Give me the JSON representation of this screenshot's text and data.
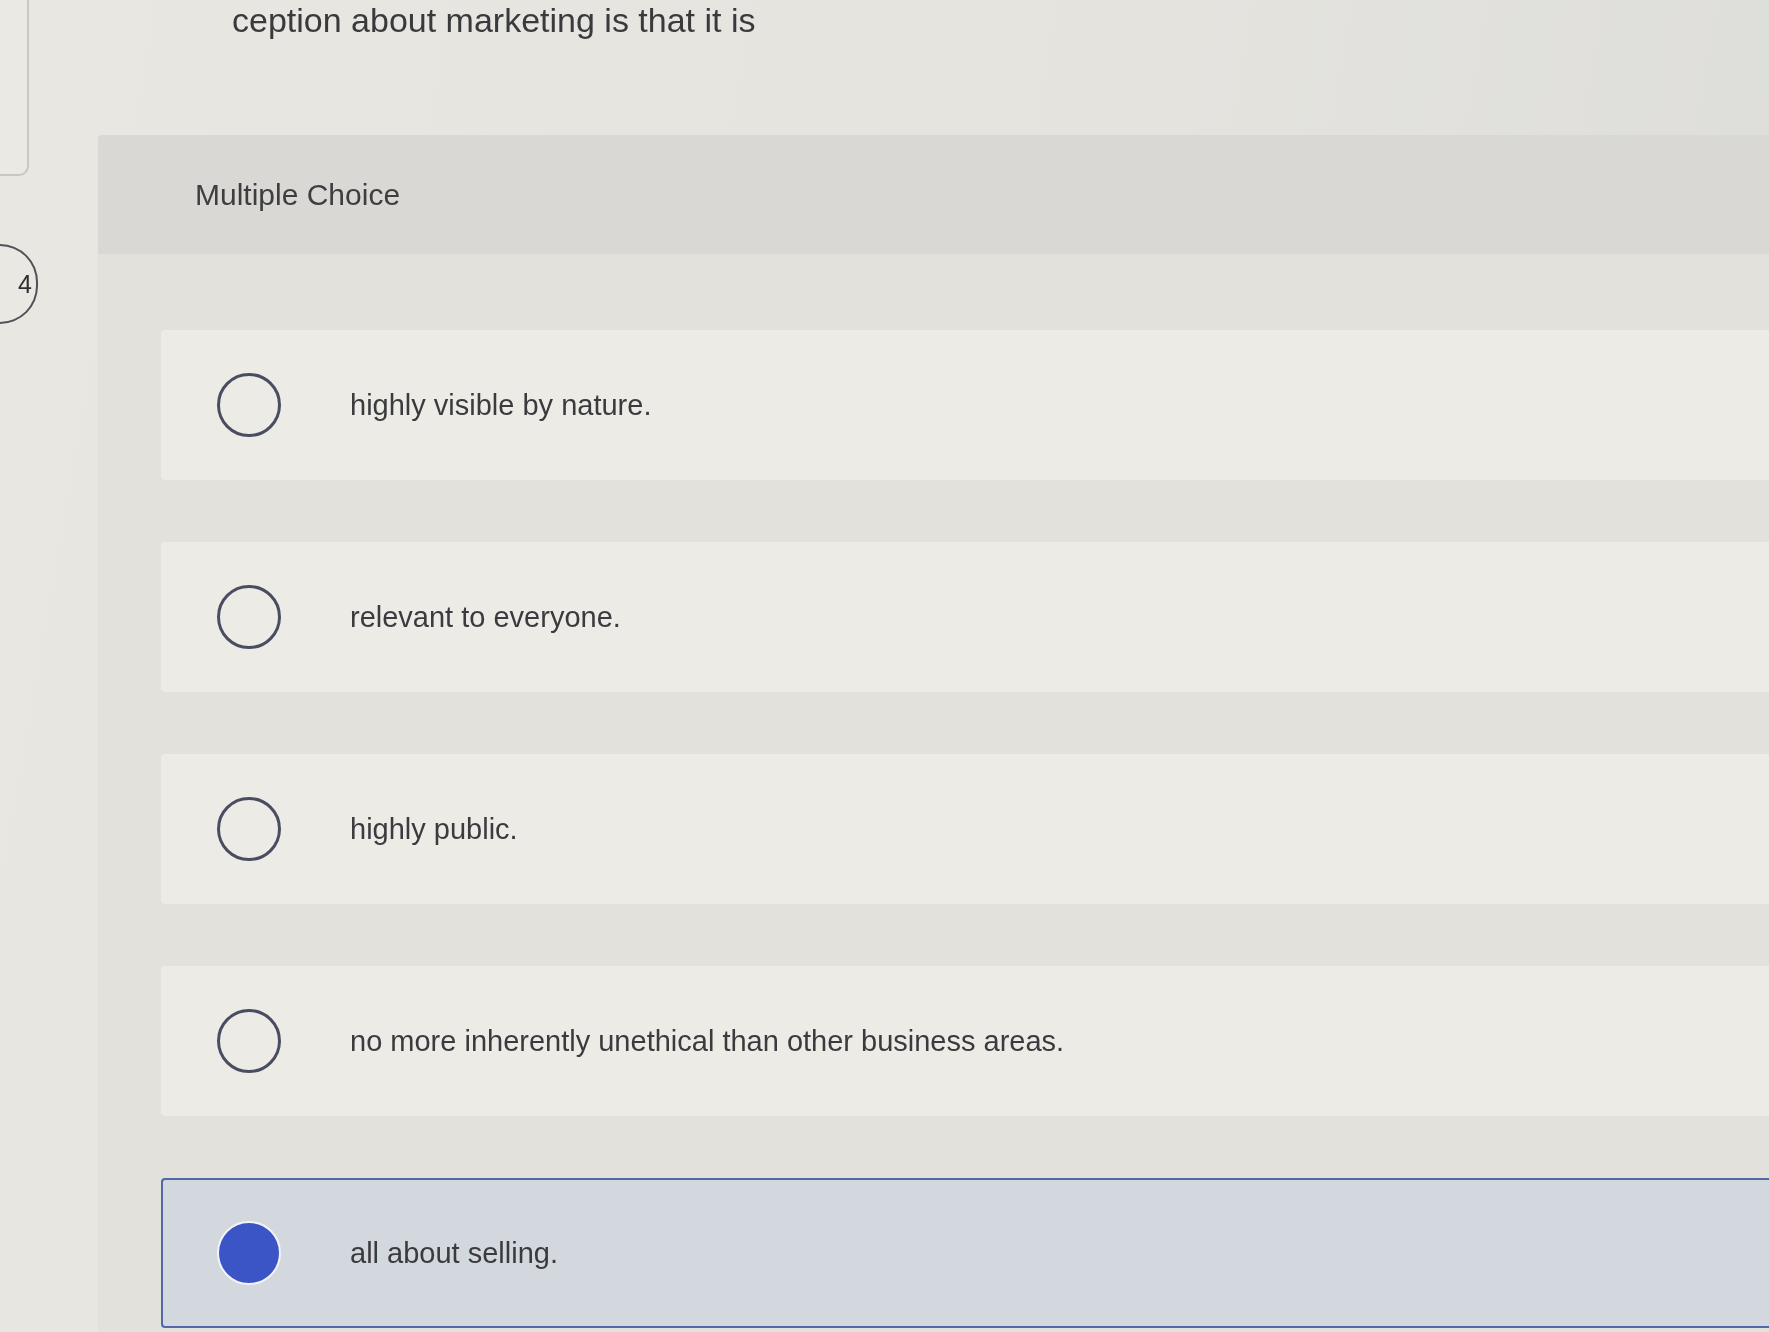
{
  "question": {
    "number": "4",
    "text": "ception about marketing is that it is"
  },
  "section": {
    "title": "Multiple Choice"
  },
  "options": [
    {
      "label": "highly visible by nature.",
      "selected": false
    },
    {
      "label": "relevant to everyone.",
      "selected": false
    },
    {
      "label": "highly public.",
      "selected": false
    },
    {
      "label": "no more inherently unethical than other business areas.",
      "selected": false
    },
    {
      "label": "all about selling.",
      "selected": true
    }
  ]
}
